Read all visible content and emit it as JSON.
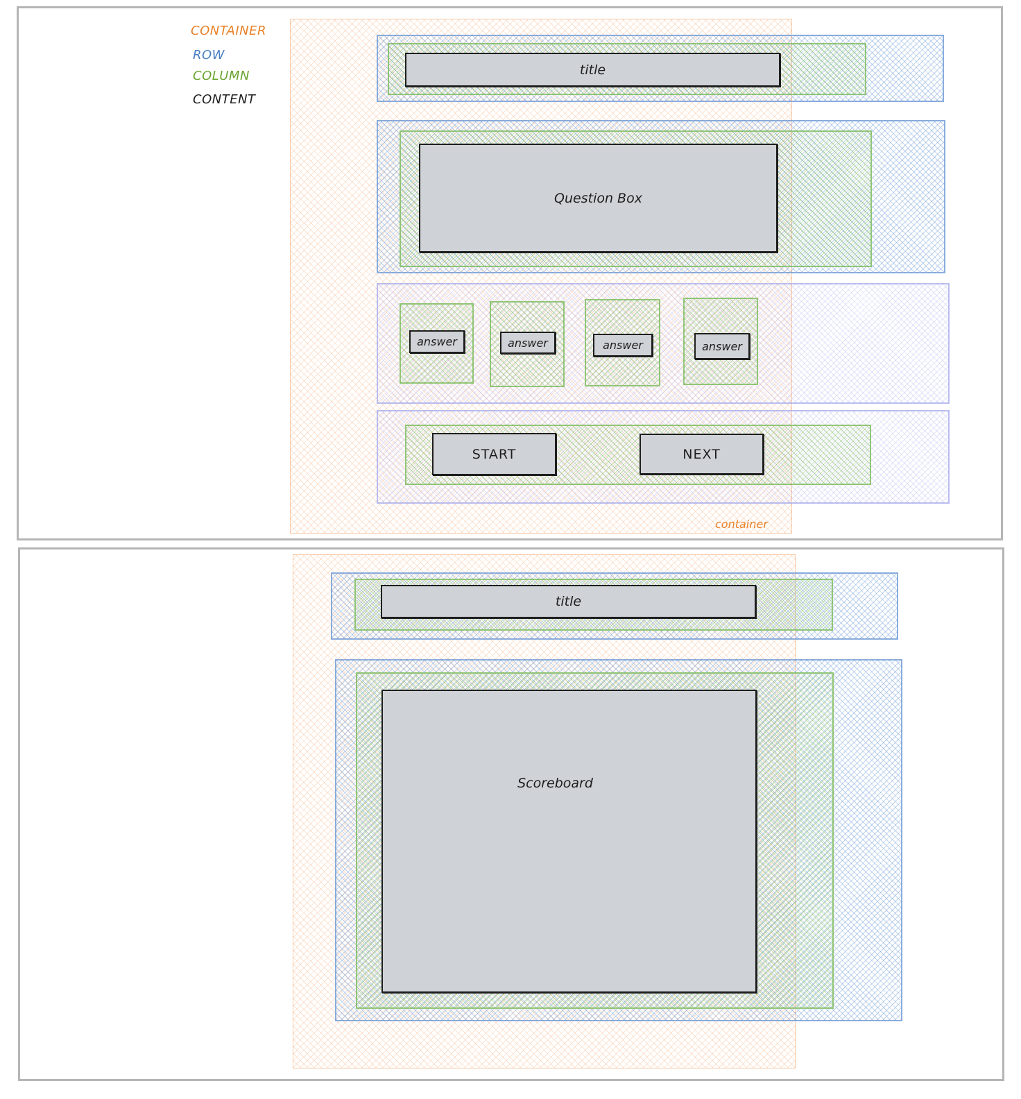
{
  "legend": {
    "container": "CONTAINER",
    "row": "ROW",
    "column": "COLUMN",
    "content": "CONTENT"
  },
  "colors": {
    "container": "#e8822a",
    "row": "#4a7fc0",
    "column": "#6aa52f",
    "content": "#1e1e1e",
    "content_fill": "#cfd2d6"
  },
  "game_screen": {
    "title": "title",
    "question_box": "Question Box",
    "answers": [
      "answer",
      "answer",
      "answer",
      "answer"
    ],
    "start_button": "START",
    "next_button": "NEXT",
    "container_label": "container"
  },
  "score_screen": {
    "title": "title",
    "scoreboard": "Scoreboard"
  }
}
